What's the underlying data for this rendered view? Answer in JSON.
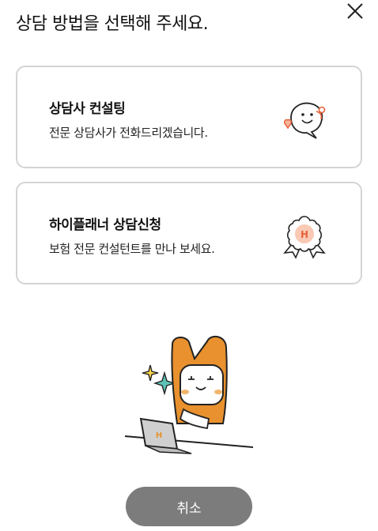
{
  "dialog": {
    "title": "상담 방법을 선택해 주세요."
  },
  "options": [
    {
      "title": "상담사 컨설팅",
      "description": "전문 상담사가 전화드리겠습니다.",
      "icon": "chat-heart-icon"
    },
    {
      "title": "하이플래너 상담신청",
      "description": "보험 전문 컨설턴트를 만나 보세요.",
      "icon": "badge-h-icon"
    }
  ],
  "illustration": {
    "icon": "mascot-laptop-illustration"
  },
  "actions": {
    "cancel_label": "취소"
  },
  "colors": {
    "accent_orange": "#E8912E",
    "card_border": "#D4D4D4",
    "cancel_button": "#7C7C7C",
    "teal": "#5BC2B5"
  }
}
